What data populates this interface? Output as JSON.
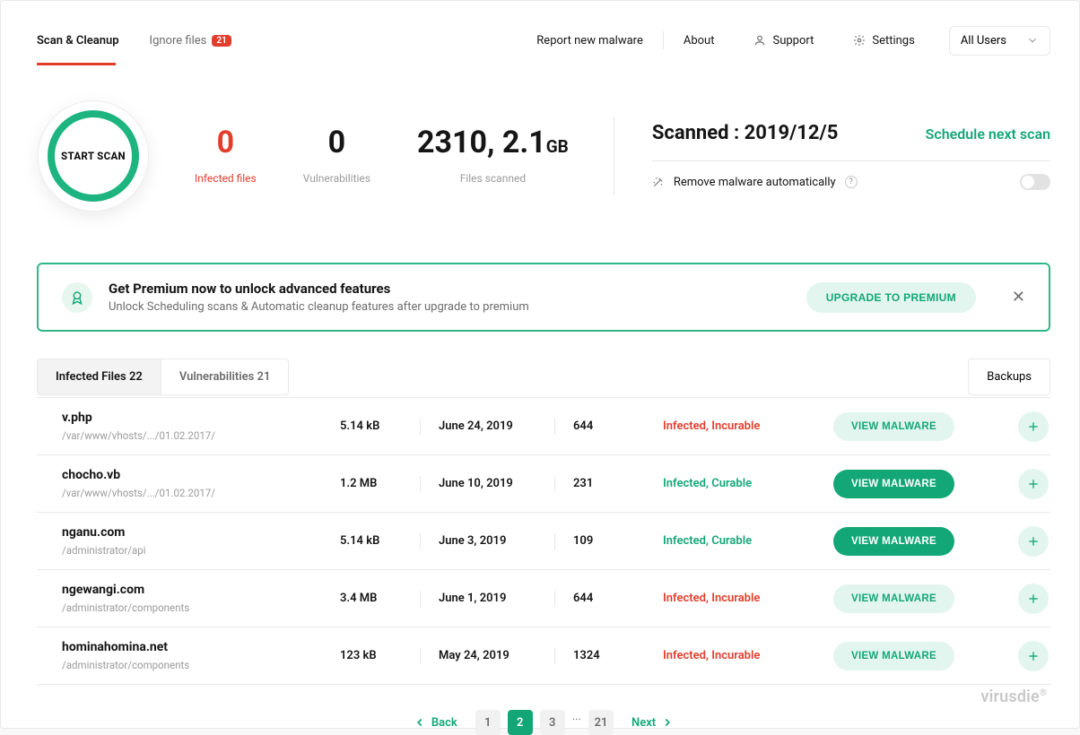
{
  "nav": {
    "tab_scan": "Scan & Cleanup",
    "tab_ignore": "Ignore files",
    "ignore_badge": "21",
    "report": "Report new malware",
    "about": "About",
    "support": "Support",
    "settings": "Settings",
    "users_select": "All Users"
  },
  "hero": {
    "start": "START SCAN",
    "infected_val": "0",
    "infected_lbl": "Infected files",
    "vuln_val": "0",
    "vuln_lbl": "Vulnerabilities",
    "scanned_val": "2310, 2.1",
    "scanned_unit": "GB",
    "scanned_lbl": "Files scanned",
    "scanned_date": "Scanned : 2019/12/5",
    "schedule": "Schedule next scan",
    "auto_remove": "Remove malware automatically"
  },
  "premium": {
    "title": "Get Premium now to unlock advanced features",
    "subtitle": "Unlock Scheduling scans & Automatic cleanup features after upgrade to premium",
    "cta": "UPGRADE TO PREMIUM"
  },
  "results": {
    "tab_infected": "Infected Files 22",
    "tab_vuln": "Vulnerabilities 21",
    "backups": "Backups",
    "view_label": "VIEW MALWARE"
  },
  "rows": [
    {
      "name": "v.php",
      "path": "/var/www/vhosts/.../01.02.2017/",
      "size": "5.14 kB",
      "date": "June 24, 2019",
      "code": "644",
      "status": "Infected, Incurable",
      "curable": false
    },
    {
      "name": "chocho.vb",
      "path": "/var/www/vhosts/.../01.02.2017/",
      "size": "1.2 MB",
      "date": "June 10, 2019",
      "code": "231",
      "status": "Infected, Curable",
      "curable": true
    },
    {
      "name": "nganu.com",
      "path": "/administrator/api",
      "size": "5.14 kB",
      "date": "June 3, 2019",
      "code": "109",
      "status": "Infected, Curable",
      "curable": true
    },
    {
      "name": "ngewangi.com",
      "path": "/administrator/components",
      "size": "3.4 MB",
      "date": "June 1, 2019",
      "code": "644",
      "status": "Infected, Incurable",
      "curable": false
    },
    {
      "name": "hominahomina.net",
      "path": "/administrator/components",
      "size": "123 kB",
      "date": "May 24, 2019",
      "code": "1324",
      "status": "Infected, Incurable",
      "curable": false
    }
  ],
  "pagination": {
    "back": "Back",
    "next": "Next",
    "pages": [
      "1",
      "2",
      "3",
      "...",
      "21"
    ],
    "active": "2"
  },
  "brand": "virusdie"
}
